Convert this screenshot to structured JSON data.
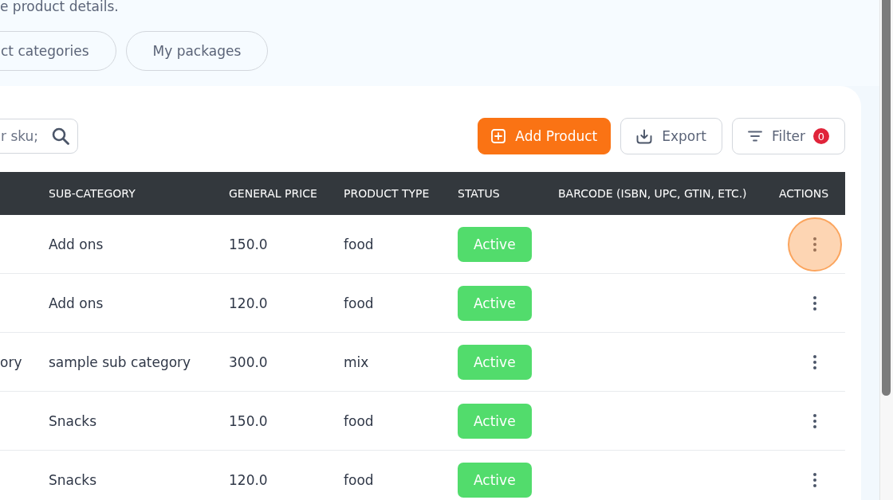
{
  "intro": {
    "text": "e product details."
  },
  "nav_pills": [
    {
      "label": "ct categories"
    },
    {
      "label": "My packages"
    }
  ],
  "toolbar": {
    "search": {
      "placeholder": "r sku;"
    },
    "buttons": [
      {
        "kind": "add",
        "label": "Add Product"
      },
      {
        "kind": "export",
        "label": "Export"
      },
      {
        "kind": "filter",
        "label": "Filter",
        "badge": "0"
      }
    ]
  },
  "table": {
    "columns": [
      "SUB-CATEGORY",
      "GENERAL PRICE",
      "PRODUCT TYPE",
      "STATUS",
      "BARCODE (ISBN, UPC, GTIN, ETC.)",
      "ACTIONS"
    ],
    "rows": [
      {
        "sub_category": "Add ons",
        "general_price": "150.0",
        "product_type": "food",
        "status": "Active",
        "actions": {
          "highlighted": true
        }
      },
      {
        "sub_category": "Add ons",
        "general_price": "120.0",
        "product_type": "food",
        "status": "Active",
        "actions": {
          "highlighted": false
        }
      },
      {
        "column_1": "ory",
        "sub_category": "sample sub category",
        "general_price": "300.0",
        "product_type": "mix",
        "status": "Active",
        "actions": {
          "highlighted": false
        }
      },
      {
        "sub_category": "Snacks",
        "general_price": "150.0",
        "product_type": "food",
        "status": "Active",
        "actions": {
          "highlighted": false
        }
      },
      {
        "sub_category": "Snacks",
        "general_price": "120.0",
        "product_type": "food",
        "status": "Active",
        "actions": {
          "highlighted": false
        }
      }
    ]
  }
}
